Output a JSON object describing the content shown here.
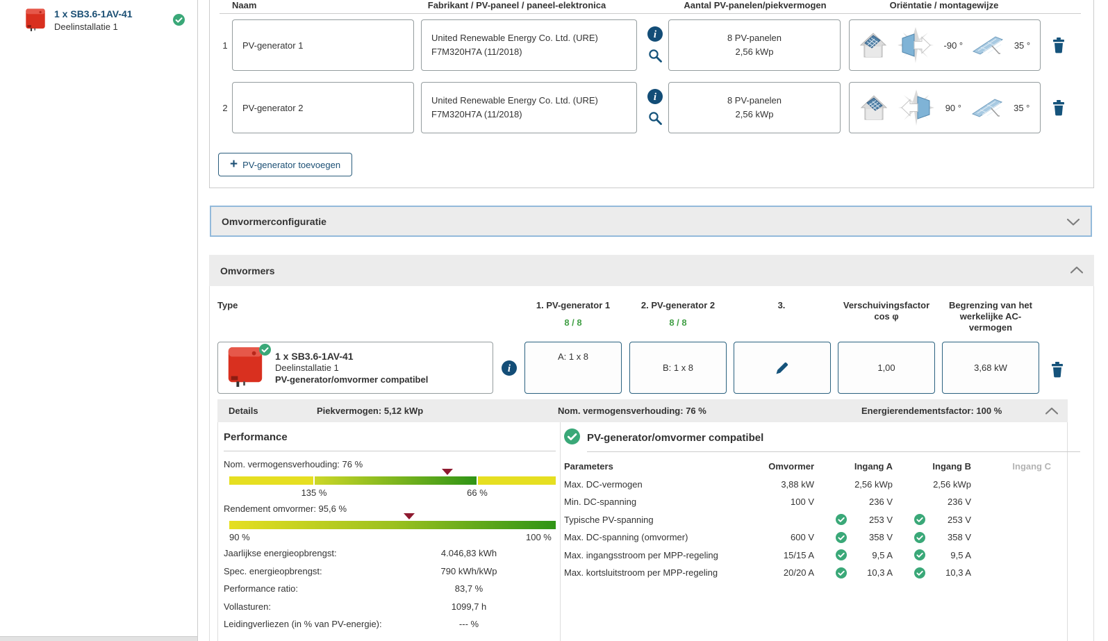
{
  "colors": {
    "accent_navy": "#15537b",
    "link_navy": "#1b4f74",
    "check_green": "#3aa878",
    "assign_green": "#43a047",
    "bar_yellow": "#e6df21",
    "bar_green": "#2f9416",
    "marker_red": "#8e1a30",
    "section_gray": "#ececec",
    "focus_border": "#93badb"
  },
  "sidebar": {
    "title": "1 x SB3.6-1AV-41",
    "subtitle": "Deelinstallatie 1"
  },
  "generators": {
    "col_naam": "Naam",
    "col_fabrikant": "Fabrikant / PV-paneel / paneel-elektronica",
    "col_aantal": "Aantal PV-panelen/piekvermogen",
    "col_orientatie": "Oriëntatie / montagewijze",
    "rows": [
      {
        "num": "1",
        "name": "PV-generator 1",
        "mfr1": "United Renewable Energy Co. Ltd. (URE)",
        "mfr2": "F7M320H7A (11/2018)",
        "panels": "8 PV-panelen",
        "kwp": "2,56 kWp",
        "azimuth": "-90 °",
        "tilt": "35 °"
      },
      {
        "num": "2",
        "name": "PV-generator 2",
        "mfr1": "United Renewable Energy Co. Ltd. (URE)",
        "mfr2": "F7M320H7A (11/2018)",
        "panels": "8 PV-panelen",
        "kwp": "2,56 kWp",
        "azimuth": "90 °",
        "tilt": "35 °"
      }
    ],
    "add_plus": "+",
    "add_label": "PV-generator toevoegen"
  },
  "config_section": {
    "title": "Omvormerconfiguratie"
  },
  "inverters": {
    "title": "Omvormers",
    "col_type": "Type",
    "col_gen1": "1. PV-generator 1",
    "gen1_assign": "8 / 8",
    "col_gen2": "2. PV-generator 2",
    "gen2_assign": "8 / 8",
    "col_3": "3.",
    "col_cos_1": "Verschuivingsfactor",
    "col_cos_2": "cos φ",
    "col_limit_1": "Begrenzing van het",
    "col_limit_2": "werkelijke AC-",
    "col_limit_3": "vermogen",
    "row": {
      "title": "1 x SB3.6-1AV-41",
      "subtitle": "Deelinstallatie 1",
      "status": "PV-generator/omvormer compatibel",
      "input_a": "A: 1 x 8",
      "input_b": "B: 1 x 8",
      "cos_phi": "1,00",
      "ac_limit": "3,68 kW"
    }
  },
  "details": {
    "label": "Details",
    "piek": "Piekvermogen: 5,12 kWp",
    "nom": "Nom. vermogensverhouding: 76 %",
    "energie": "Energierendementsfactor: 100 %"
  },
  "performance": {
    "title": "Performance",
    "gauge1": {
      "label": "Nom. vermogensverhouding: 76 %",
      "tick1": "135 %",
      "tick2": "66 %",
      "marker_left": "66.8%",
      "tick1_left": "26%",
      "tick2_left": "76%"
    },
    "gauge2": {
      "label": "Rendement omvormer: 95,6 %",
      "tick_left": "90 %",
      "tick_right": "100 %",
      "marker_left": "55%"
    },
    "stats": [
      {
        "label": "Jaarlijkse energieopbrengst:",
        "value": "4.046,83 kWh"
      },
      {
        "label": "Spec. energieopbrengst:",
        "value": "790 kWh/kWp"
      },
      {
        "label": "Performance ratio:",
        "value": "83,7 %"
      },
      {
        "label": "Vollasturen:",
        "value": "1099,7 h"
      },
      {
        "label": "Leidingverliezen (in % van PV-energie):",
        "value": "--- %"
      }
    ]
  },
  "compat": {
    "title": "PV-generator/omvormer compatibel",
    "col_param": "Parameters",
    "col_omv": "Omvormer",
    "col_a": "Ingang A",
    "col_b": "Ingang B",
    "col_c": "Ingang C",
    "rows": [
      {
        "label": "Max. DC-vermogen",
        "omv": "3,88 kW",
        "a": "2,56 kWp",
        "b": "2,56 kWp"
      },
      {
        "label": "Min. DC-spanning",
        "omv": "100 V",
        "a": "236 V",
        "b": "236 V"
      },
      {
        "label": "Typische PV-spanning",
        "omv": "",
        "a": "253 V",
        "b": "253 V"
      },
      {
        "label": "Max. DC-spanning (omvormer)",
        "omv": "600 V",
        "a": "358 V",
        "b": "358 V"
      },
      {
        "label": "Max. ingangsstroom per MPP-regeling",
        "omv": "15/15 A",
        "a": "9,5 A",
        "b": "9,5 A"
      },
      {
        "label": "Max. kortsluitstroom per MPP-regeling",
        "omv": "20/20 A",
        "a": "10,3 A",
        "b": "10,3 A"
      }
    ]
  }
}
